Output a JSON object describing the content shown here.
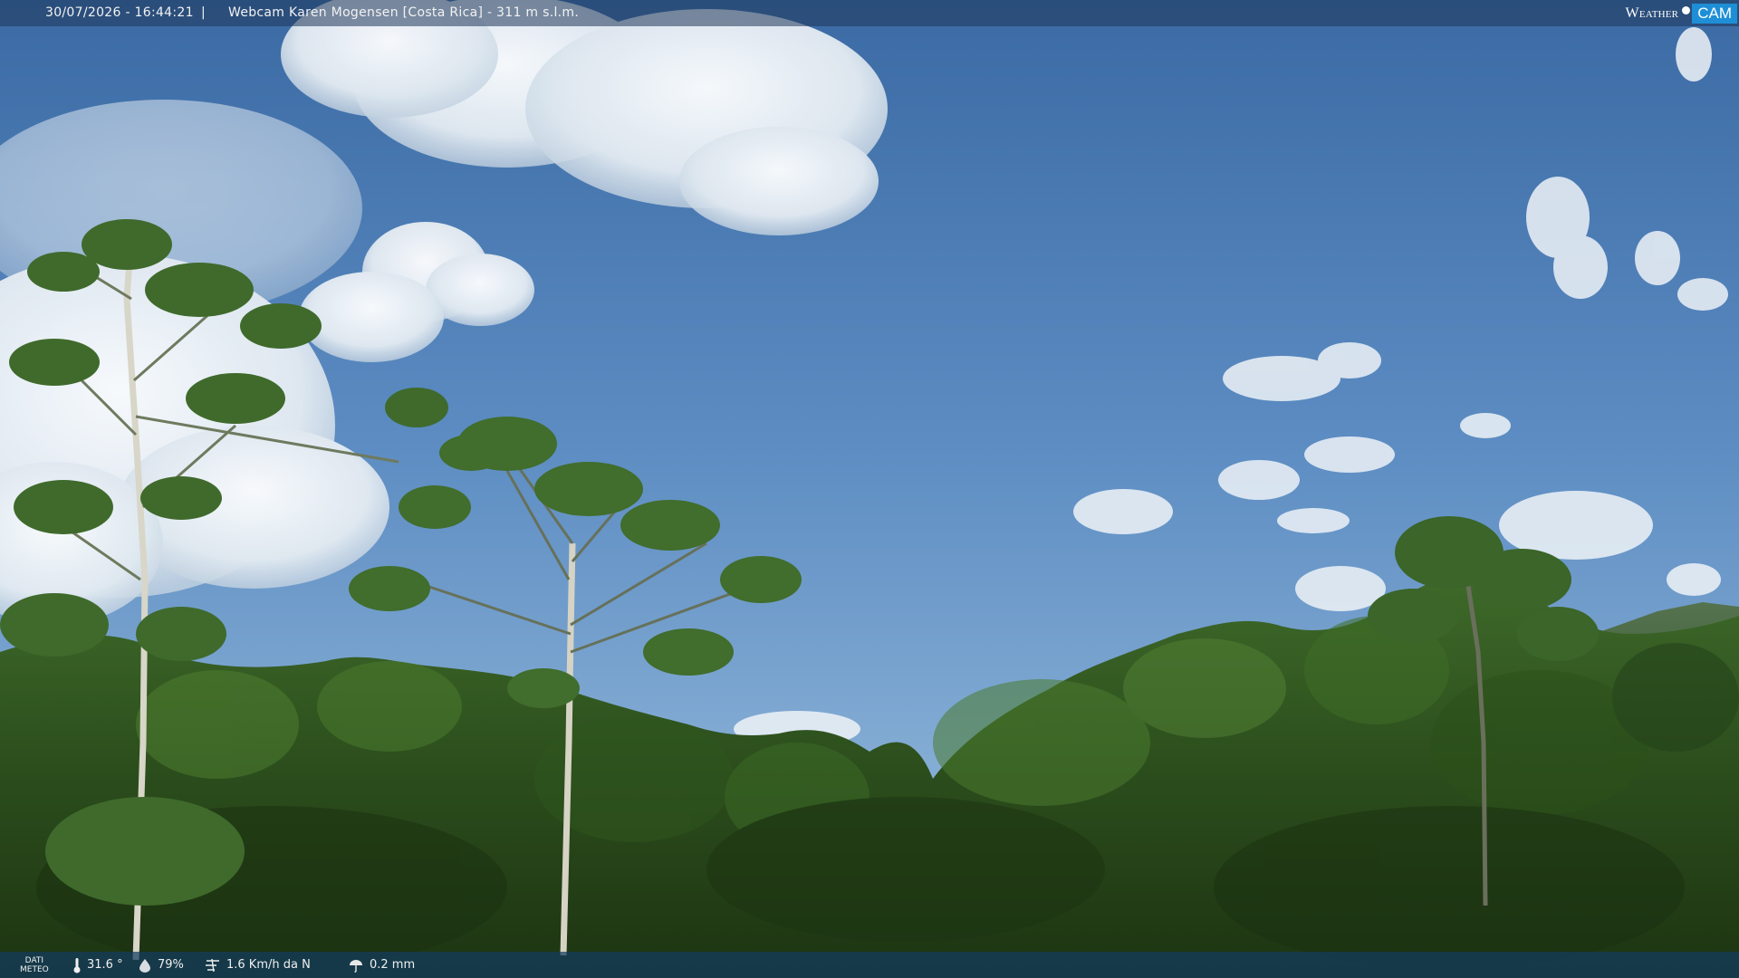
{
  "overlay": {
    "timestamp": "30/07/2026 - 16:44:21",
    "separator": "|",
    "title": "Webcam Karen Mogensen [Costa Rica] - 311 m s.l.m."
  },
  "brand": {
    "weather": "Weather",
    "cam": "CAM"
  },
  "meteo": {
    "label_line1": "DATI",
    "label_line2": "METEO",
    "temperature": "31.6 °",
    "humidity": "79%",
    "wind": "1.6 Km/h da N",
    "rain": "0.2 mm"
  },
  "colors": {
    "sky_top": "#3f6fa8",
    "sky_horizon": "#8fb6d8",
    "foliage_dark": "#1f3d14",
    "foliage_mid": "#3e6b26",
    "cloud": "#eef3f7",
    "brand_accent": "#1e8fd6"
  },
  "icons": {
    "temperature": "thermometer-icon",
    "humidity": "humidity-drop-icon",
    "wind": "wind-icon",
    "rain": "rain-icon"
  }
}
